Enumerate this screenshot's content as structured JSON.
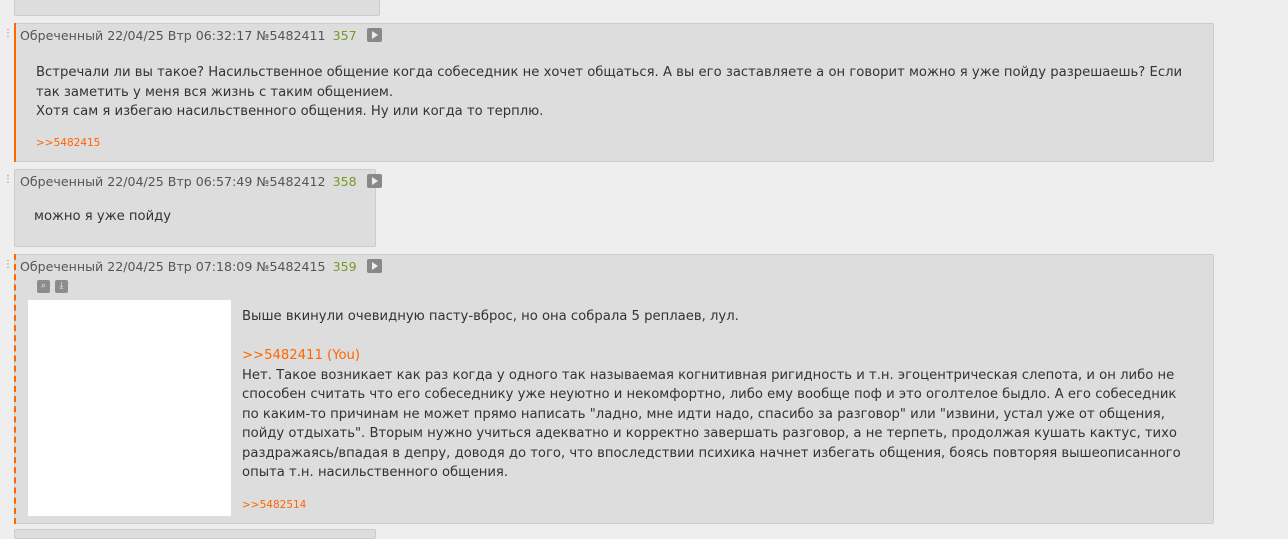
{
  "posts": [
    {
      "author": "Обреченный",
      "date": "22/04/25 Втр 06:32:17",
      "id": "№5482411",
      "index": "357",
      "lines": [
        "Встречали ли вы такое? Насильственное общение когда собеседник не хочет общаться. А вы его заставляете а он говорит можно я уже пойду разрешаешь? Если",
        "так заметить у меня вся жизнь с таким общением.",
        "Хотя сам я избегаю насильственного общения. Ну или когда то терплю."
      ],
      "backlink": ">>5482415"
    },
    {
      "author": "Обреченный",
      "date": "22/04/25 Втр 06:57:49",
      "id": "№5482412",
      "index": "358",
      "lines": [
        "можно я уже пойду"
      ]
    },
    {
      "author": "Обреченный",
      "date": "22/04/25 Втр 07:18:09",
      "id": "№5482415",
      "index": "359",
      "first_line": "Выше вкинули очевидную пасту-вброс, но она собрала 5 реплаев, лул.",
      "quote_link": ">>5482411",
      "you_tag": "(You)",
      "lines": [
        "Нет. Такое возникает как раз когда у одного так называемая когнитивная ригидность и т.н. эгоцентрическая слепота, и он либо не",
        "способен считать что его собеседнику уже неуютно и некомфортно, либо ему вообще поф и это оголтелое быдло. А его собеседник",
        "по каким-то причинам не может прямо написать \"ладно, мне идти надо, спасибо за разговор\" или \"извини, устал уже от общения,",
        "пойду отдыхать\". Вторым нужно учиться адекватно и корректно завершать разговор, а не терпеть, продолжая кушать кактус, тихо",
        "раздражаясь/впадая в депру, доводя до того, что впоследствии психика начнет избегать общения, боясь повторяя вышеописанного",
        "опыта т.н. насильственного общения."
      ],
      "backlink": ">>5482514"
    }
  ],
  "dots": ".:",
  "icons": {
    "search": "search-icon",
    "download": "download-icon",
    "play": "play-icon"
  }
}
